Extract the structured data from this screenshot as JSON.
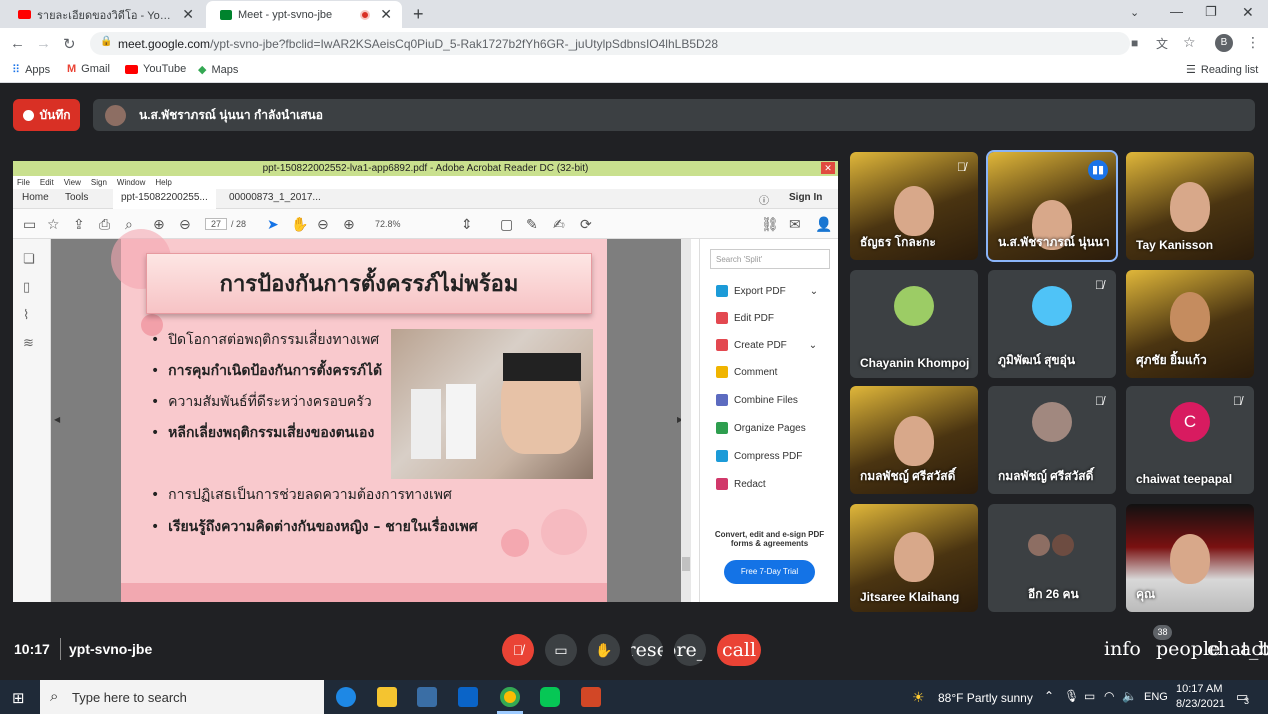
{
  "tabs": [
    {
      "title": "รายละเอียดของวิดีโอ - YouTube Studio",
      "active": false
    },
    {
      "title": "Meet - ypt-svno-jbe",
      "active": true
    }
  ],
  "address": {
    "domain": "meet.google.com",
    "path": "/ypt-svno-jbe?fbclid=IwAR2KSAeisCq0PiuD_5-Rak1727b2fYh6GR-_juUtylpSdbnsIO4lhLB5D28"
  },
  "bookmarks": [
    "Apps",
    "Gmail",
    "YouTube",
    "Maps"
  ],
  "reading_list": "Reading list",
  "profile_initial": "B",
  "meet": {
    "record_label": "บันทึก",
    "presenter_text": "น.ส.พัชราภรณ์ นุ่นนา กำลังนำเสนอ",
    "meeting_time": "10:17",
    "meeting_code": "ypt-svno-jbe",
    "participant_count": "38",
    "ctrl_present": "present",
    "ctrl_more": "more_vert",
    "ctrl_call": "call",
    "ctrl_info": "info",
    "ctrl_people": "people",
    "ctrl_chat": "chat_bubble",
    "ctrl_activity": "activities"
  },
  "acrobat": {
    "title": "ppt-150822002552-lva1-app6892.pdf - Adobe Acrobat Reader DC (32-bit)",
    "menu": [
      "File",
      "Edit",
      "View",
      "Sign",
      "Window",
      "Help"
    ],
    "tabs": [
      "Home",
      "Tools",
      "ppt-15082200255...",
      "00000873_1_2017..."
    ],
    "sign_in": "Sign In",
    "page_current": "27",
    "page_total": "/ 28",
    "zoom": "72.8%",
    "search_placeholder": "Search 'Split'",
    "tools": [
      "Export PDF",
      "Edit PDF",
      "Create PDF",
      "Comment",
      "Combine Files",
      "Organize Pages",
      "Compress PDF",
      "Redact"
    ],
    "promo": "Convert, edit and e-sign PDF forms & agreements",
    "trial": "Free 7-Day Trial"
  },
  "slide": {
    "title": "การป้องกันการตั้งครรภ์ไม่พร้อม",
    "bullets": [
      "ปิดโอกาสต่อพฤติกรรมเสี่ยงทางเพศ",
      "การคุมกำเนิดป้องกันการตั้งครรภ์ได้",
      "ความสัมพันธ์ที่ดีระหว่างครอบครัว",
      "หลีกเลี่ยงพฤติกรรมเสี่ยงของตนเอง",
      "การปฏิเสธเป็นการช่วยลดความต้องการทางเพศ",
      "เรียนรู้ถึงความคิดต่างกันของหญิง – ชายในเรื่องเพศ"
    ]
  },
  "participants": [
    {
      "name": "ธัญธร โกละกะ"
    },
    {
      "name": "น.ส.พัชราภรณ์ นุ่นนา"
    },
    {
      "name": "Tay Kanisson"
    },
    {
      "name": "Chayanin Khompoj"
    },
    {
      "name": "ภูมิพัฒน์ สุขอุ่น"
    },
    {
      "name": "ศุภชัย ยิ้มแก้ว"
    },
    {
      "name": "กมลพัชญ์ ศรีสวัสดิ์"
    },
    {
      "name": "กมลพัชญ์ ศรีสวัสดิ์"
    },
    {
      "name": "chaiwat teepapal",
      "initial": "C"
    },
    {
      "name": "Jitsaree Klaihang"
    },
    {
      "name": "อีก 26 คน"
    },
    {
      "name": "คุณ"
    }
  ],
  "taskbar": {
    "search_placeholder": "Type here to search",
    "weather": "88°F  Partly sunny",
    "lang": "ENG",
    "time": "10:17 AM",
    "date": "8/23/2021",
    "notifications": "3"
  },
  "colors": {
    "record": "#d93025",
    "end_call": "#ea4335",
    "accent": "#1473e6",
    "avatar_c": "#d81b60"
  }
}
